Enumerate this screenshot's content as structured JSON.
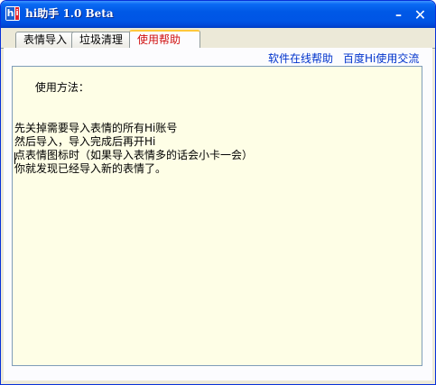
{
  "window": {
    "title": "hi助手 1.0 Beta",
    "minimize_glyph": "–",
    "close_glyph": "✕"
  },
  "tabs": [
    {
      "label": "表情导入",
      "active": false
    },
    {
      "label": "垃圾清理",
      "active": false
    },
    {
      "label": "使用帮助",
      "active": true
    }
  ],
  "links": {
    "online_help": "软件在线帮助",
    "forum": "百度Hi使用交流"
  },
  "help_text": "使用方法：\n\n\n先关掉需要导入表情的所有Hi账号\n然后导入，导入完成后再开Hi\n点表情图标时（如果导入表情多的话会小卡一会）\n你就发现已经导入新的表情了。",
  "colors": {
    "titlebar": "#0055e5",
    "active_tab_text": "#d01010",
    "link": "#0033cc",
    "textarea_bg": "#fefee6"
  }
}
